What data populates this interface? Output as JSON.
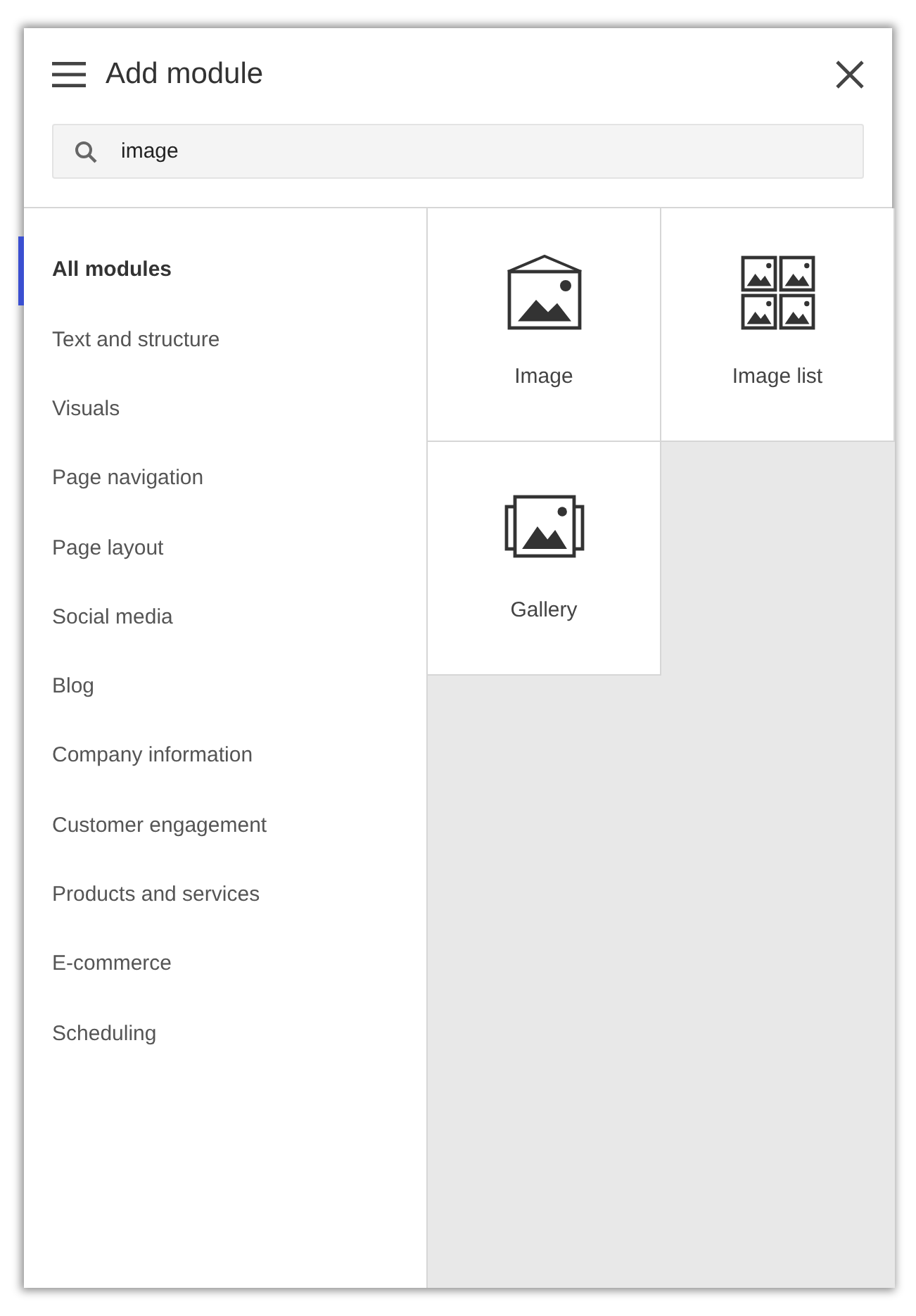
{
  "dialog": {
    "title": "Add module"
  },
  "search": {
    "value": "image"
  },
  "categories": [
    {
      "label": "All modules",
      "selected": true
    },
    {
      "label": "Text and structure",
      "selected": false
    },
    {
      "label": "Visuals",
      "selected": false
    },
    {
      "label": "Page navigation",
      "selected": false
    },
    {
      "label": "Page layout",
      "selected": false
    },
    {
      "label": "Social media",
      "selected": false
    },
    {
      "label": "Blog",
      "selected": false
    },
    {
      "label": "Company information",
      "selected": false
    },
    {
      "label": "Customer engagement",
      "selected": false
    },
    {
      "label": "Products and services",
      "selected": false
    },
    {
      "label": "E-commerce",
      "selected": false
    },
    {
      "label": "Scheduling",
      "selected": false
    }
  ],
  "modules": [
    {
      "label": "Image",
      "kind": "image"
    },
    {
      "label": "Image list",
      "kind": "image-list"
    },
    {
      "label": "Gallery",
      "kind": "gallery"
    }
  ]
}
